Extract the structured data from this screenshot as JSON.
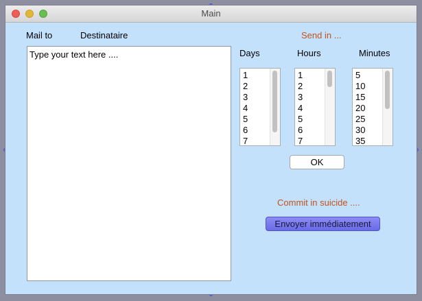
{
  "window": {
    "title": "Main"
  },
  "form": {
    "mail_to_label": "Mail to",
    "destinataire_label": "Destinataire",
    "message_placeholder": "Type your text here ....",
    "send_in_label": "Send in ...",
    "days_label": "Days",
    "hours_label": "Hours",
    "minutes_label": "Minutes",
    "days_options": [
      "1",
      "2",
      "3",
      "4",
      "5",
      "6",
      "7"
    ],
    "hours_options": [
      "1",
      "2",
      "3",
      "4",
      "5",
      "6",
      "7"
    ],
    "minutes_options": [
      "5",
      "10",
      "15",
      "20",
      "25",
      "30",
      "35"
    ],
    "ok_label": "OK",
    "commit_label": "Commit in suicide ....",
    "send_now_label": "Envoyer immédiatement"
  },
  "colors": {
    "window_bg": "#c3e1fb",
    "accent_orange": "#c3521e",
    "primary_button": "#7b7bf0"
  }
}
